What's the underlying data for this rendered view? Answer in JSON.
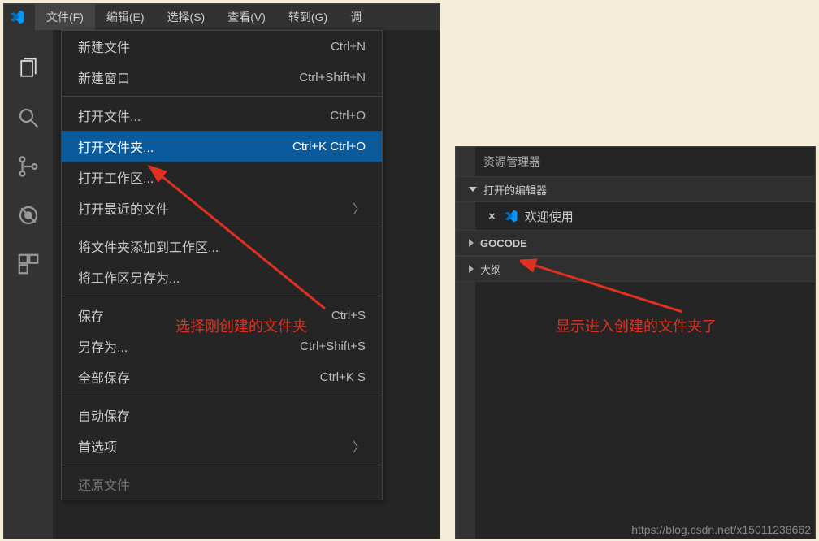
{
  "menubar": {
    "items": [
      "文件(F)",
      "编辑(E)",
      "选择(S)",
      "查看(V)",
      "转到(G)",
      "调"
    ]
  },
  "file_menu": {
    "groups": [
      [
        {
          "label": "新建文件",
          "shortcut": "Ctrl+N",
          "sub": false
        },
        {
          "label": "新建窗口",
          "shortcut": "Ctrl+Shift+N",
          "sub": false
        }
      ],
      [
        {
          "label": "打开文件...",
          "shortcut": "Ctrl+O",
          "sub": false
        },
        {
          "label": "打开文件夹...",
          "shortcut": "Ctrl+K Ctrl+O",
          "sub": false,
          "highlight": true
        },
        {
          "label": "打开工作区...",
          "shortcut": "",
          "sub": false
        },
        {
          "label": "打开最近的文件",
          "shortcut": "",
          "sub": true
        }
      ],
      [
        {
          "label": "将文件夹添加到工作区...",
          "shortcut": "",
          "sub": false
        },
        {
          "label": "将工作区另存为...",
          "shortcut": "",
          "sub": false
        }
      ],
      [
        {
          "label": "保存",
          "shortcut": "Ctrl+S",
          "sub": false
        },
        {
          "label": "另存为...",
          "shortcut": "Ctrl+Shift+S",
          "sub": false
        },
        {
          "label": "全部保存",
          "shortcut": "Ctrl+K S",
          "sub": false
        }
      ],
      [
        {
          "label": "自动保存",
          "shortcut": "",
          "sub": false
        },
        {
          "label": "首选项",
          "shortcut": "",
          "sub": true
        }
      ],
      [
        {
          "label": "还原文件",
          "shortcut": "",
          "sub": false,
          "dim": true
        }
      ]
    ]
  },
  "annotations": {
    "left": "选择刚创建的文件夹",
    "right": "显示进入创建的文件夹了"
  },
  "explorer": {
    "title": "资源管理器",
    "open_editors_label": "打开的编辑器",
    "open_editor_item": "欢迎使用",
    "folder_name": "GOCODE",
    "outline_label": "大纲"
  },
  "watermark": "https://blog.csdn.net/x15011238662"
}
